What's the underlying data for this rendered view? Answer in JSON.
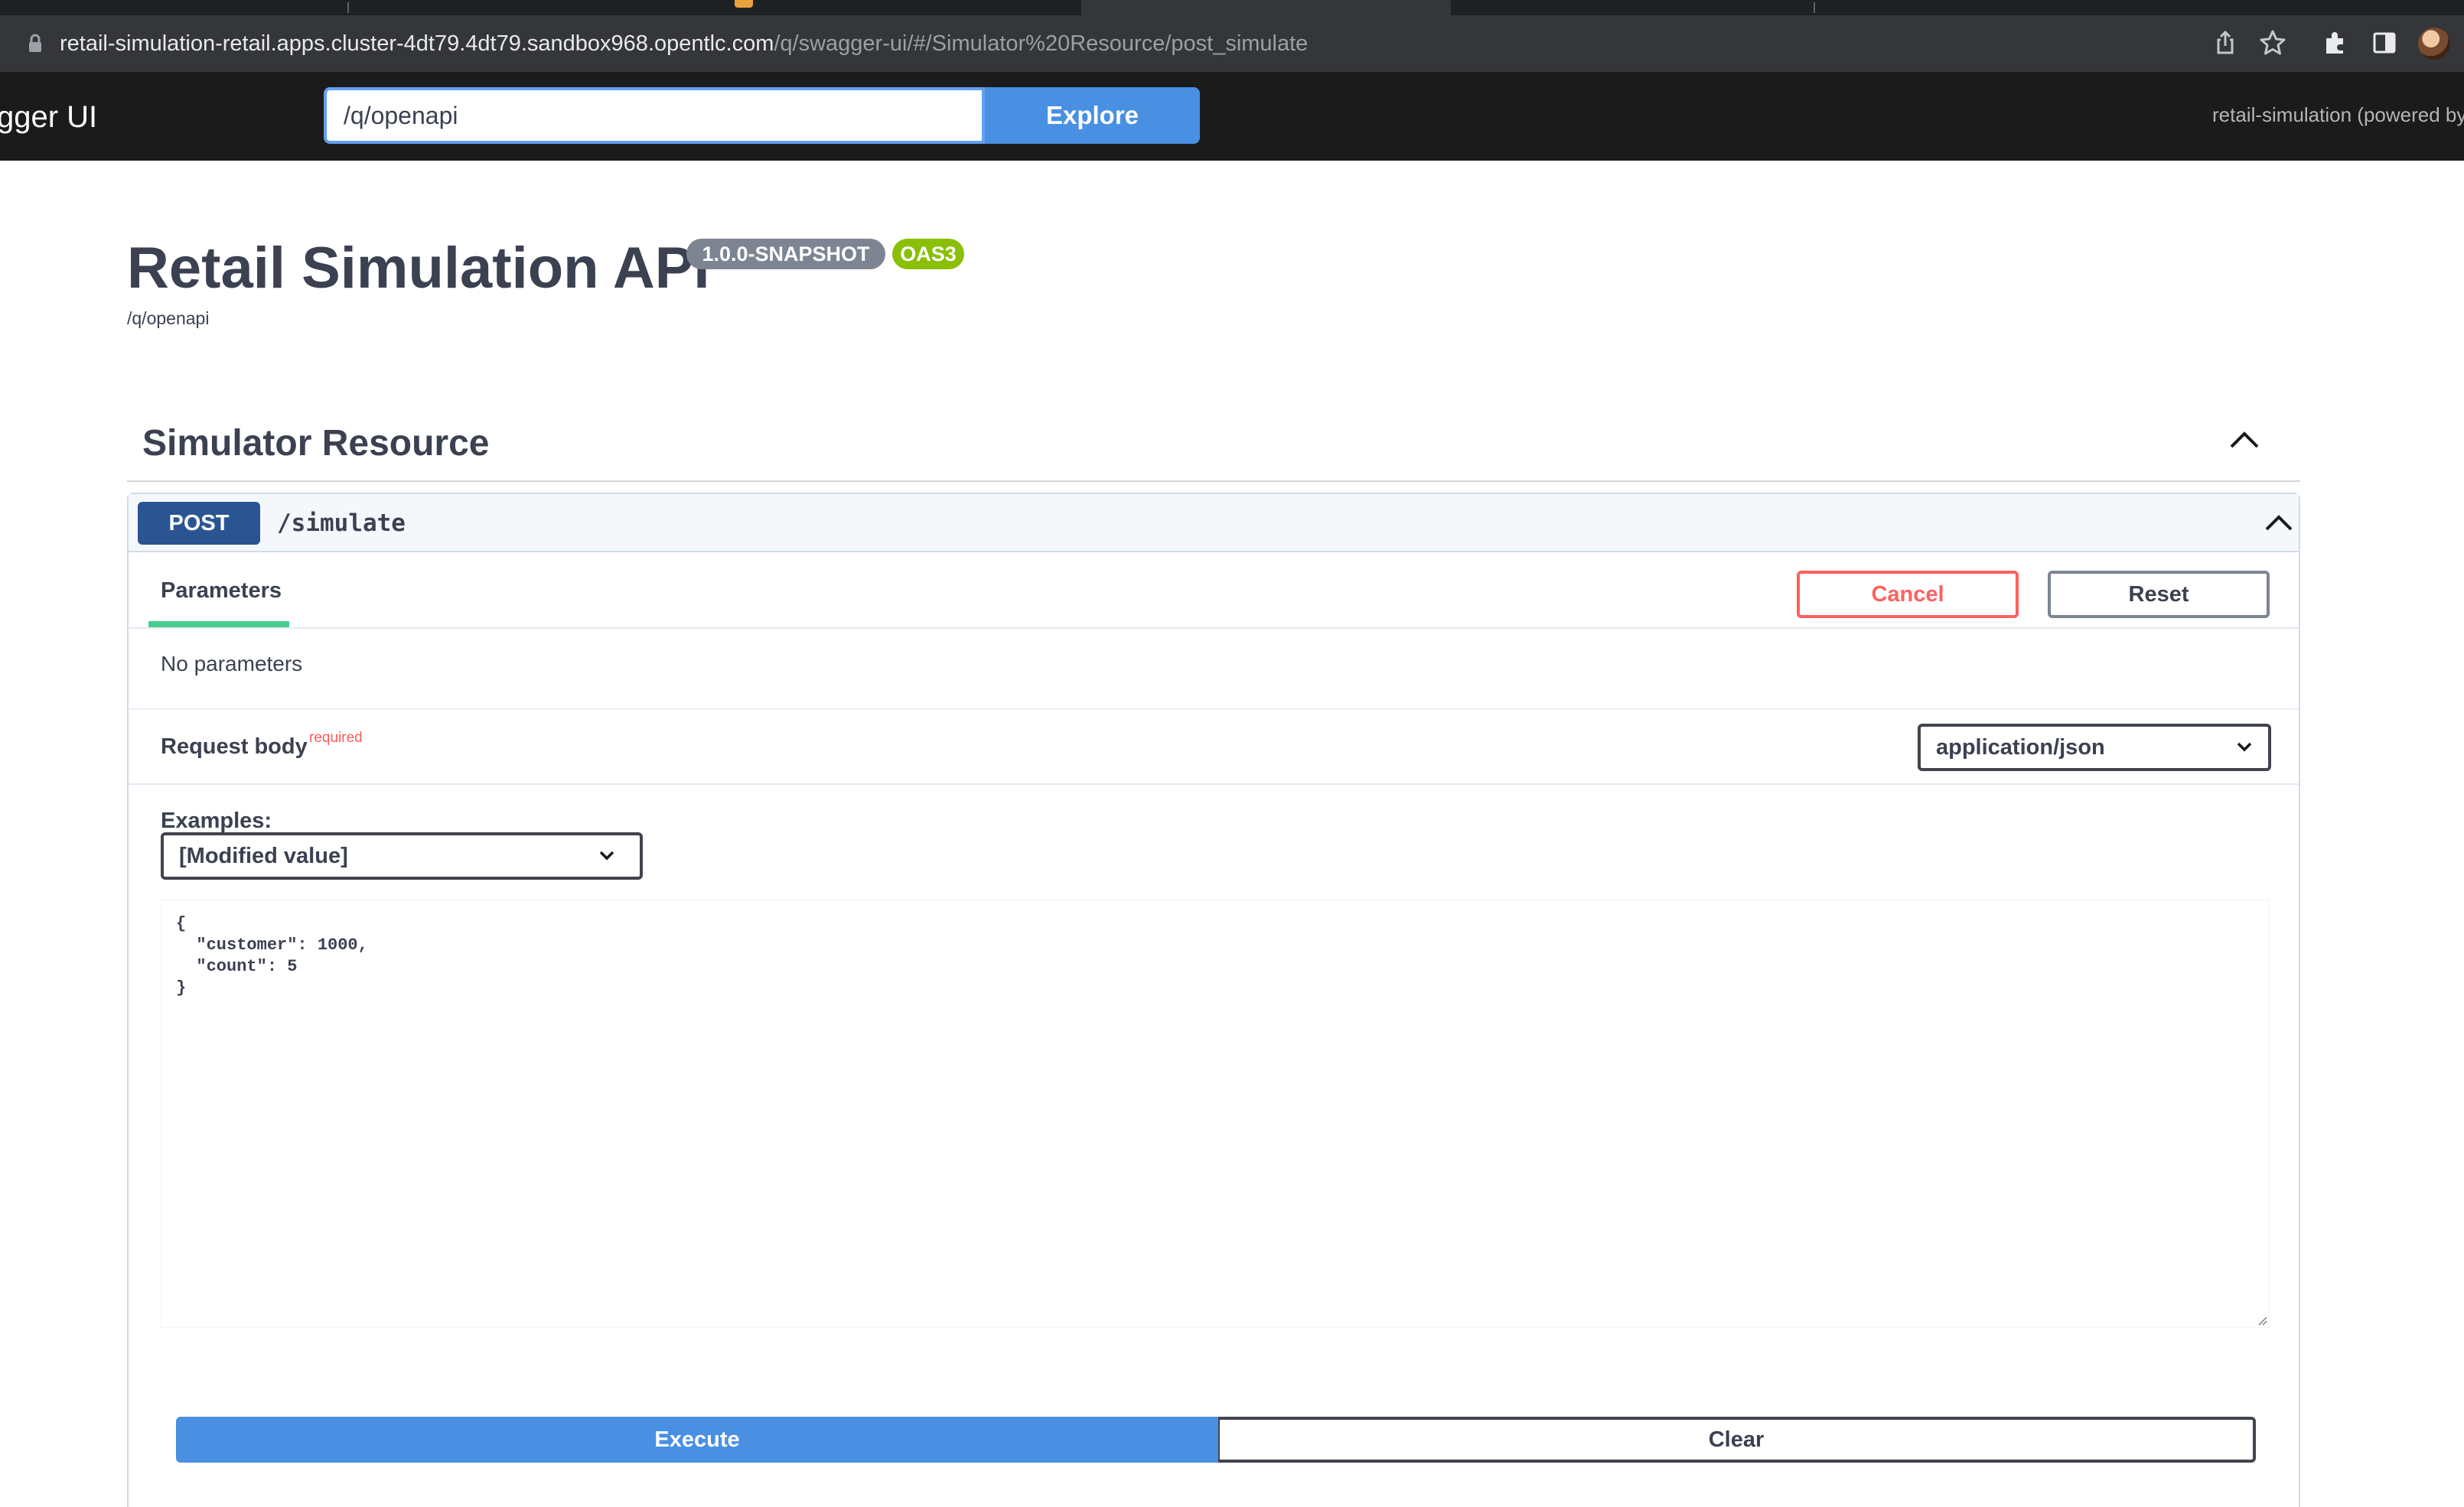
{
  "browser": {
    "url_host": "retail-simulation-retail.apps.cluster-4dt79.4dt79.sandbox968.opentlc.com",
    "url_path": "/q/swagger-ui/#/Simulator%20Resource/post_simulate",
    "icons": [
      "lock-icon",
      "share-icon",
      "star-icon",
      "extensions-icon",
      "sidepanel-icon",
      "profile-avatar"
    ]
  },
  "topbar": {
    "brand": "gger UI",
    "spec_url": "/q/openapi",
    "explore_label": "Explore",
    "powered_by": "retail-simulation (powered by"
  },
  "info": {
    "title": "Retail Simulation API",
    "version_badge": "1.0.0-SNAPSHOT",
    "oas_badge": "OAS3",
    "spec_link": "/q/openapi"
  },
  "tag": {
    "title": "Simulator Resource"
  },
  "operation": {
    "method": "POST",
    "path": "/simulate",
    "tab_parameters": "Parameters",
    "cancel_label": "Cancel",
    "reset_label": "Reset",
    "no_params": "No parameters",
    "request_body_label": "Request body",
    "required_label": "required",
    "content_type": "application/json",
    "examples_label": "Examples:",
    "example_selected": "[Modified value]",
    "body_text": "{\n  \"customer\": 1000,\n  \"count\": 5\n}",
    "execute_label": "Execute",
    "clear_label": "Clear"
  },
  "colors": {
    "post": "#2b5592",
    "execute": "#4990e2",
    "cancel": "#ff6060",
    "oas": "#89bf04",
    "version": "#7d8492",
    "topbar": "#1b1b1b"
  }
}
